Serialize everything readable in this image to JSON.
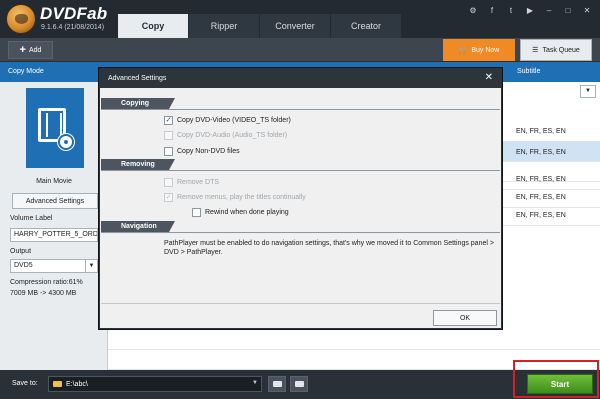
{
  "app": {
    "name": "DVDFab",
    "version": "9.1.6.4 (21/08/2014)"
  },
  "tabs": [
    {
      "label": "Copy",
      "active": true
    },
    {
      "label": "Ripper",
      "active": false
    },
    {
      "label": "Converter",
      "active": false
    },
    {
      "label": "Creator",
      "active": false
    }
  ],
  "top_icons": [
    "settings-icon",
    "facebook-icon",
    "twitter-icon",
    "youtube-icon",
    "minimize-icon",
    "maximize-icon",
    "close-icon"
  ],
  "toolbar": {
    "add_label": "Add",
    "buy_label": "Buy Now",
    "task_label": "Task Queue"
  },
  "columns": {
    "copy_mode": "Copy Mode",
    "subtitle": "Subtitle"
  },
  "left_panel": {
    "mode_label": "Main Movie",
    "advanced_button": "Advanced Settings",
    "volume_label_caption": "Volume Label",
    "volume_label_value": "HARRY_POTTER_5_ORD",
    "output_caption": "Output",
    "output_value": "DVD5",
    "compression": "Compression ratio:61%",
    "size": "7009 MB -> 4300 MB"
  },
  "subtitle_rows": [
    {
      "value": "EN, FR, ES, EN",
      "selected": false
    },
    {
      "value": "EN, FR, ES, EN",
      "selected": true
    },
    {
      "value": "",
      "selected": false
    },
    {
      "value": "EN, FR, ES, EN",
      "selected": false
    },
    {
      "value": "EN, FR, ES, EN",
      "selected": false
    },
    {
      "value": "EN, FR, ES, EN",
      "selected": false
    }
  ],
  "dialog": {
    "title": "Advanced Settings",
    "ok": "OK",
    "sections": {
      "copying": "Copying",
      "removing": "Removing",
      "navigation": "Navigation"
    },
    "options": {
      "copy_dvd_video": {
        "label": "Copy DVD-Video (VIDEO_TS folder)",
        "checked": true,
        "enabled": true
      },
      "copy_dvd_audio": {
        "label": "Copy DVD-Audio (Audio_TS folder)",
        "checked": false,
        "enabled": false
      },
      "copy_non_dvd": {
        "label": "Copy Non-DVD files",
        "checked": false,
        "enabled": true
      },
      "remove_dts": {
        "label": "Remove DTS",
        "checked": false,
        "enabled": false
      },
      "remove_menus": {
        "label": "Remove menus, play the titles continually",
        "checked": true,
        "enabled": false
      },
      "rewind": {
        "label": "Rewind when done playing",
        "checked": false,
        "enabled": true
      }
    },
    "navigation_text": "PathPlayer must be enabled to do navigation settings, that's why we moved it to Common Settings panel > DVD > PathPlayer."
  },
  "bottom": {
    "save_to_label": "Save to:",
    "path": "E:\\abc\\",
    "start_label": "Start"
  },
  "colors": {
    "accent_blue": "#1e6fb4",
    "buy_orange": "#f08a24",
    "start_green": "#4fa12a",
    "highlight_red": "#d81f26"
  }
}
